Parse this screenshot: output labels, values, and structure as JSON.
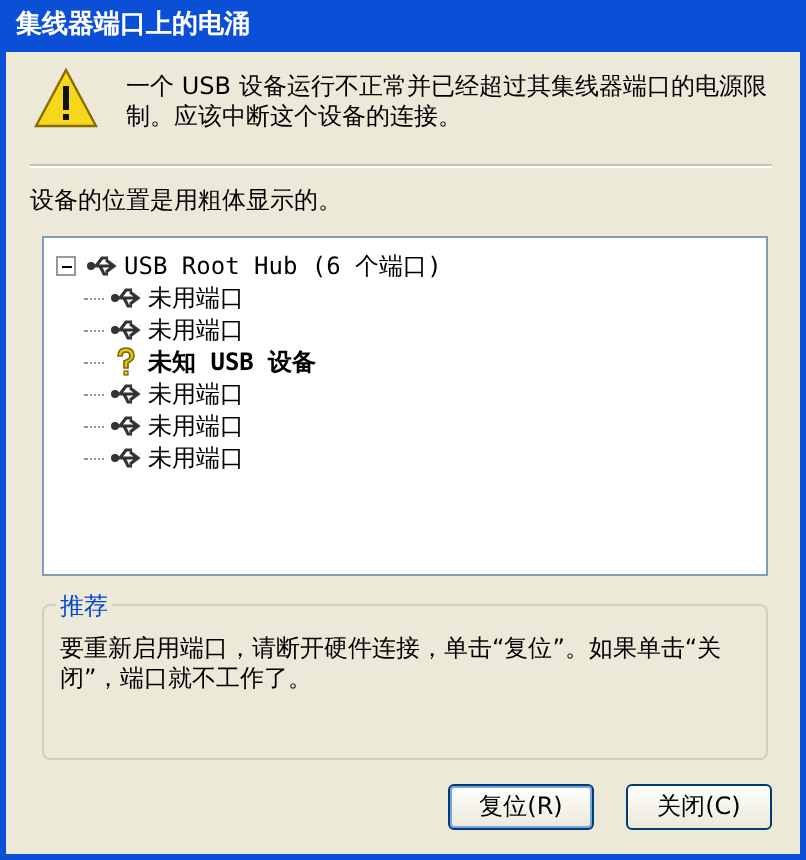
{
  "window": {
    "title": "集线器端口上的电涌"
  },
  "message": "一个 USB 设备运行不正常并已经超过其集线器端口的电源限制。应该中断这个设备的连接。",
  "location_note": "设备的位置是用粗体显示的。",
  "tree": [
    {
      "label": "USB Root Hub (6 个端口)",
      "expanded": true,
      "children": [
        {
          "label": "未用端口",
          "kind": "port"
        },
        {
          "label": "未用端口",
          "kind": "port"
        },
        {
          "label": "未知 USB 设备",
          "kind": "device"
        },
        {
          "label": "未用端口",
          "kind": "port"
        },
        {
          "label": "未用端口",
          "kind": "port"
        },
        {
          "label": "未用端口",
          "kind": "port"
        }
      ]
    }
  ],
  "recommendation": {
    "title": "推荐",
    "text": "要重新启用端口，请断开硬件连接，单击“复位”。如果单击“关闭”，端口就不工作了。"
  },
  "buttons": [
    "复位(R)",
    "关闭(C)"
  ]
}
